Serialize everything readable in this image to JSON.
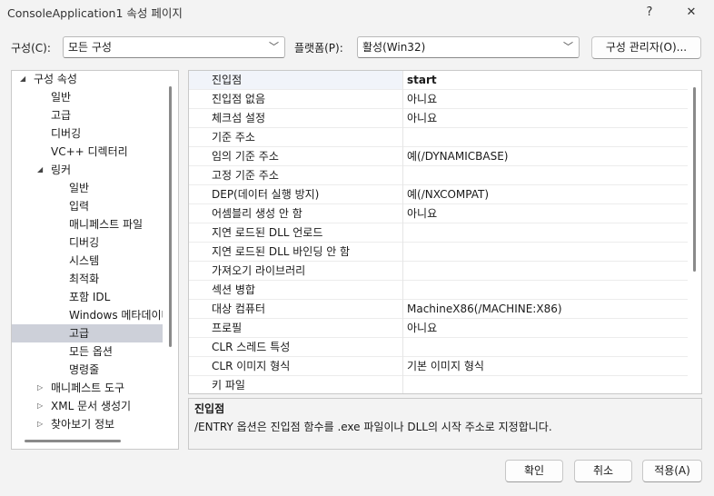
{
  "window": {
    "title": "ConsoleApplication1 속성 페이지",
    "help_glyph": "?",
    "close_glyph": "✕"
  },
  "toolbar": {
    "config_label": "구성(C):",
    "config_value": "모든 구성",
    "platform_label": "플랫폼(P):",
    "platform_value": "활성(Win32)",
    "manager_button": "구성 관리자(O)..."
  },
  "tree": {
    "items": [
      {
        "label": "구성 속성",
        "arrow": "◢",
        "indent": 0
      },
      {
        "label": "일반",
        "indent": 1
      },
      {
        "label": "고급",
        "indent": 1
      },
      {
        "label": "디버깅",
        "indent": 1
      },
      {
        "label": "VC++ 디렉터리",
        "indent": 1
      },
      {
        "label": "링커",
        "arrow": "◢",
        "indent": 1
      },
      {
        "label": "일반",
        "indent": 2
      },
      {
        "label": "입력",
        "indent": 2
      },
      {
        "label": "매니페스트 파일",
        "indent": 2
      },
      {
        "label": "디버깅",
        "indent": 2
      },
      {
        "label": "시스템",
        "indent": 2
      },
      {
        "label": "최적화",
        "indent": 2
      },
      {
        "label": "포함 IDL",
        "indent": 2
      },
      {
        "label": "Windows 메타데이터",
        "indent": 2
      },
      {
        "label": "고급",
        "indent": 2,
        "selected": true
      },
      {
        "label": "모든 옵션",
        "indent": 2
      },
      {
        "label": "명령줄",
        "indent": 2
      },
      {
        "label": "매니페스트 도구",
        "arrow": "▷",
        "indent": 1
      },
      {
        "label": "XML 문서 생성기",
        "arrow": "▷",
        "indent": 1
      },
      {
        "label": "찾아보기 정보",
        "arrow": "▷",
        "indent": 1
      }
    ]
  },
  "grid": {
    "rows": [
      {
        "name": "진입점",
        "value": "start"
      },
      {
        "name": "진입점 없음",
        "value": "아니요"
      },
      {
        "name": "체크섬 설정",
        "value": "아니요"
      },
      {
        "name": "기준 주소",
        "value": ""
      },
      {
        "name": "임의 기준 주소",
        "value": "예(/DYNAMICBASE)"
      },
      {
        "name": "고정 기준 주소",
        "value": ""
      },
      {
        "name": "DEP(데이터 실행 방지)",
        "value": "예(/NXCOMPAT)"
      },
      {
        "name": "어셈블리 생성 안 함",
        "value": "아니요"
      },
      {
        "name": "지연 로드된 DLL 언로드",
        "value": ""
      },
      {
        "name": "지연 로드된 DLL 바인딩 안 함",
        "value": ""
      },
      {
        "name": "가져오기 라이브러리",
        "value": ""
      },
      {
        "name": "섹션 병합",
        "value": ""
      },
      {
        "name": "대상 컴퓨터",
        "value": "MachineX86(/MACHINE:X86)"
      },
      {
        "name": "프로필",
        "value": "아니요"
      },
      {
        "name": "CLR 스레드 특성",
        "value": ""
      },
      {
        "name": "CLR 이미지 형식",
        "value": "기본 이미지 형식"
      },
      {
        "name": "키 파일",
        "value": ""
      }
    ]
  },
  "description": {
    "title": "진입점",
    "text": "/ENTRY 옵션은 진입점 함수를 .exe 파일이나 DLL의 시작 주소로 지정합니다."
  },
  "buttons": {
    "ok": "확인",
    "cancel": "취소",
    "apply": "적용(A)"
  }
}
